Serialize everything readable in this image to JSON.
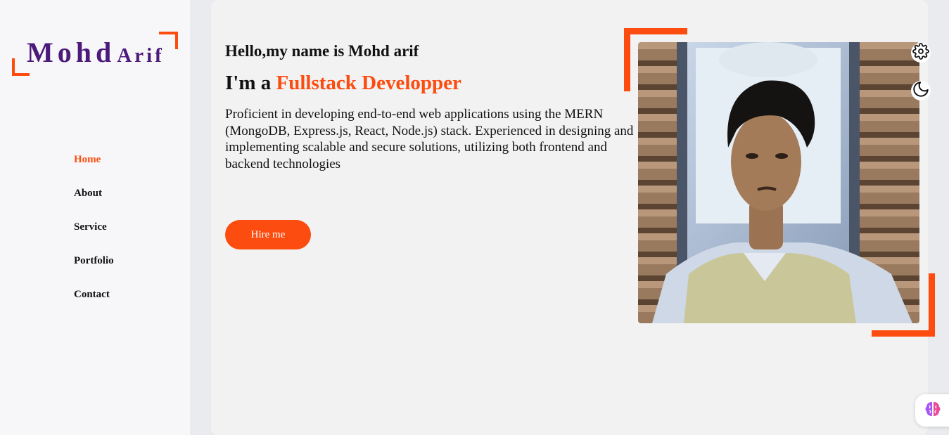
{
  "logo": {
    "first": "Mohd",
    "last": "Arif"
  },
  "nav": {
    "items": [
      {
        "label": "Home",
        "active": true
      },
      {
        "label": "About",
        "active": false
      },
      {
        "label": "Service",
        "active": false
      },
      {
        "label": "Portfolio",
        "active": false
      },
      {
        "label": "Contact",
        "active": false
      }
    ]
  },
  "hero": {
    "greeting": "Hello,my name is Mohd arif",
    "role_prefix": "I'm a ",
    "role_accent": "Fullstack Developper",
    "description": "Proficient in developing end-to-end web applications using the MERN (MongoDB, Express.js, React, Node.js) stack. Experienced in designing and implementing scalable and secure solutions, utilizing both frontend and backend technologies",
    "hire_button": "Hire me"
  },
  "icons": {
    "settings": "gear-icon",
    "theme": "moon-icon",
    "assistant": "brain-icon"
  },
  "colors": {
    "accent": "#fc4c0f",
    "logo": "#4c1a7a",
    "sidebar_bg": "#f7f7f9",
    "main_bg": "#f2f2f2"
  }
}
